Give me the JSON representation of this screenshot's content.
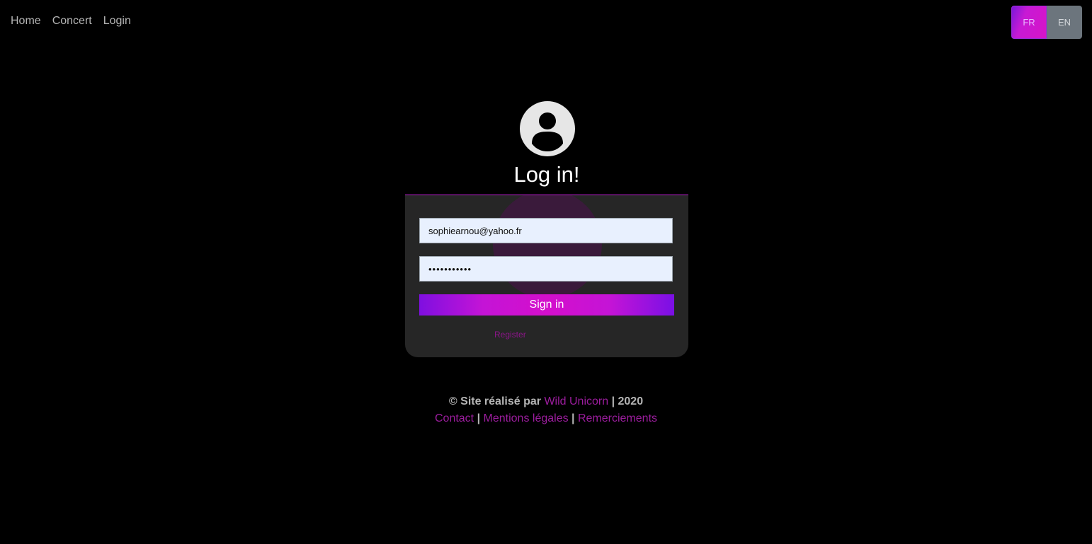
{
  "nav": {
    "home": "Home",
    "concert": "Concert",
    "login": "Login"
  },
  "lang": {
    "fr": "FR",
    "en": "EN",
    "active": "FR"
  },
  "login": {
    "icon": "user-avatar-icon",
    "title": "Log in!",
    "email_value": "sophiearnou@yahoo.fr",
    "password_value": "•••••••••••",
    "signin_label": "Sign in",
    "register_label": "Register"
  },
  "footer": {
    "copyright": "© Site réalisé par",
    "author": "Wild Unicorn",
    "year": "| 2020",
    "sep": "|",
    "contact": "Contact",
    "legal": "Mentions légales",
    "thanks": "Remerciements"
  },
  "colors": {
    "background": "#000000",
    "card": "#262626",
    "accent": "#c414d6",
    "link": "#9c1d9e"
  }
}
